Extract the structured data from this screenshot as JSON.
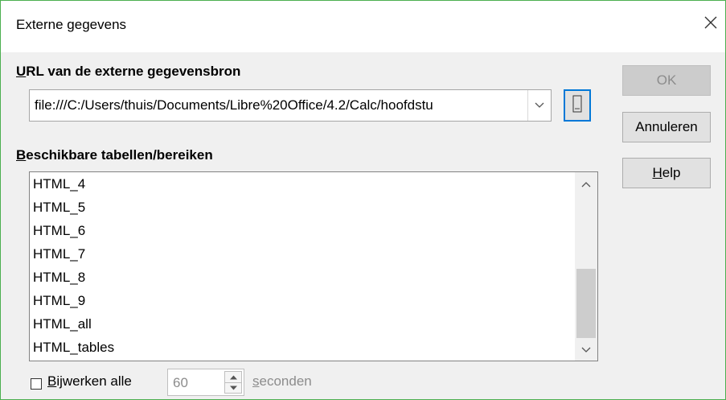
{
  "window": {
    "title": "Externe gegevens"
  },
  "url_section": {
    "label_u": "U",
    "label_rest": "RL van de externe gegevensbron",
    "url_value": "file:///C:/Users/thuis/Documents/Libre%20Office/4.2/Calc/hoofdstu"
  },
  "tables_section": {
    "label_u": "B",
    "label_rest": "eschikbare tabellen/bereiken",
    "items": [
      "HTML_4",
      "HTML_5",
      "HTML_6",
      "HTML_7",
      "HTML_8",
      "HTML_9",
      "HTML_all",
      "HTML_tables"
    ]
  },
  "update": {
    "label_u": "B",
    "label_rest": "ijwerken alle",
    "checked": false,
    "interval": "60",
    "unit_u": "s",
    "unit_rest": "econden"
  },
  "buttons": {
    "ok": "OK",
    "cancel": "Annuleren",
    "help_u": "H",
    "help_rest": "elp"
  },
  "colors": {
    "window_border": "#4caf50",
    "focus_border": "#0078d7",
    "dialog_bg": "#f0f0f0",
    "disabled_text": "#8c8c8c"
  }
}
